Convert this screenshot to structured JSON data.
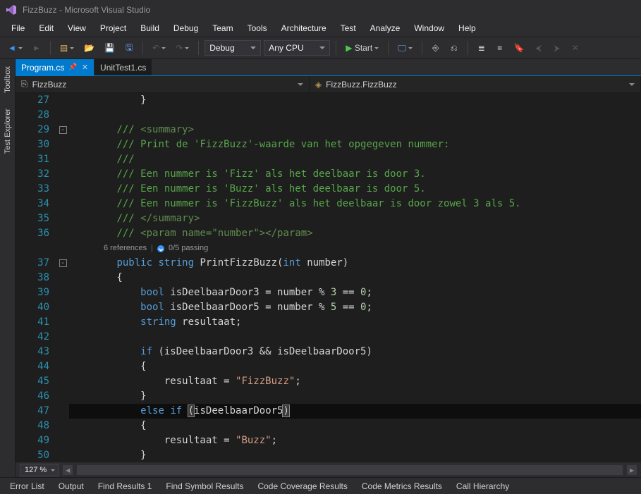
{
  "window": {
    "title": "FizzBuzz - Microsoft Visual Studio"
  },
  "menu": [
    "File",
    "Edit",
    "View",
    "Project",
    "Build",
    "Debug",
    "Team",
    "Tools",
    "Architecture",
    "Test",
    "Analyze",
    "Window",
    "Help"
  ],
  "toolbar": {
    "config": "Debug",
    "platform": "Any CPU",
    "start": "Start"
  },
  "leftTabs": [
    "Toolbox",
    "Test Explorer"
  ],
  "docTabs": [
    {
      "label": "Program.cs",
      "active": true,
      "pinned": true
    },
    {
      "label": "UnitTest1.cs",
      "active": false,
      "pinned": false
    }
  ],
  "navDropdowns": {
    "left": "FizzBuzz",
    "right": "FizzBuzz.FizzBuzz"
  },
  "code": {
    "firstLine": 27,
    "codelens": {
      "refs": "6 references",
      "tests": "0/5 passing"
    },
    "lines": [
      {
        "n": 27,
        "segs": [
          [
            "            }",
            "def"
          ]
        ]
      },
      {
        "n": 28,
        "segs": [
          [
            "",
            "def"
          ]
        ]
      },
      {
        "n": 29,
        "fold": "-",
        "segs": [
          [
            "        ",
            "def"
          ],
          [
            "/// ",
            "com"
          ],
          [
            "<summary>",
            "comg"
          ]
        ]
      },
      {
        "n": 30,
        "segs": [
          [
            "        ",
            "def"
          ],
          [
            "/// ",
            "com"
          ],
          [
            "Print de 'FizzBuzz'-waarde van het opgegeven nummer:",
            "com"
          ]
        ]
      },
      {
        "n": 31,
        "segs": [
          [
            "        ",
            "def"
          ],
          [
            "///",
            "com"
          ]
        ]
      },
      {
        "n": 32,
        "segs": [
          [
            "        ",
            "def"
          ],
          [
            "/// ",
            "com"
          ],
          [
            "Een nummer is 'Fizz' als het deelbaar is door 3.",
            "com"
          ]
        ]
      },
      {
        "n": 33,
        "segs": [
          [
            "        ",
            "def"
          ],
          [
            "/// ",
            "com"
          ],
          [
            "Een nummer is 'Buzz' als het deelbaar is door 5.",
            "com"
          ]
        ]
      },
      {
        "n": 34,
        "segs": [
          [
            "        ",
            "def"
          ],
          [
            "/// ",
            "com"
          ],
          [
            "Een nummer is 'FizzBuzz' als het deelbaar is door zowel 3 als 5.",
            "com"
          ]
        ]
      },
      {
        "n": 35,
        "segs": [
          [
            "        ",
            "def"
          ],
          [
            "/// ",
            "com"
          ],
          [
            "</summary>",
            "comg"
          ]
        ]
      },
      {
        "n": 36,
        "segs": [
          [
            "        ",
            "def"
          ],
          [
            "/// ",
            "com"
          ],
          [
            "<param ",
            "comg"
          ],
          [
            "name",
            "comg"
          ],
          [
            "=",
            "comg"
          ],
          [
            "\"number\"",
            "comg"
          ],
          [
            ">",
            "comg"
          ],
          [
            "</param>",
            "comg"
          ]
        ]
      },
      {
        "n": 0,
        "codelens": true
      },
      {
        "n": 37,
        "fold": "-",
        "segs": [
          [
            "        ",
            "def"
          ],
          [
            "public",
            "kw"
          ],
          [
            " ",
            "def"
          ],
          [
            "string",
            "kw"
          ],
          [
            " ",
            "def"
          ],
          [
            "PrintFizzBuzz",
            "def"
          ],
          [
            "(",
            "def"
          ],
          [
            "int",
            "kw"
          ],
          [
            " ",
            "def"
          ],
          [
            "number",
            "def"
          ],
          [
            ")",
            "def"
          ]
        ]
      },
      {
        "n": 38,
        "segs": [
          [
            "        {",
            "def"
          ]
        ]
      },
      {
        "n": 39,
        "segs": [
          [
            "            ",
            "def"
          ],
          [
            "bool",
            "kw"
          ],
          [
            " isDeelbaarDoor3 = number % ",
            "def"
          ],
          [
            "3",
            "num"
          ],
          [
            " == ",
            "def"
          ],
          [
            "0",
            "num"
          ],
          [
            ";",
            "def"
          ]
        ]
      },
      {
        "n": 40,
        "segs": [
          [
            "            ",
            "def"
          ],
          [
            "bool",
            "kw"
          ],
          [
            " isDeelbaarDoor5 = number % ",
            "def"
          ],
          [
            "5",
            "num"
          ],
          [
            " == ",
            "def"
          ],
          [
            "0",
            "num"
          ],
          [
            ";",
            "def"
          ]
        ]
      },
      {
        "n": 41,
        "segs": [
          [
            "            ",
            "def"
          ],
          [
            "string",
            "kw"
          ],
          [
            " resultaat;",
            "def"
          ]
        ]
      },
      {
        "n": 42,
        "segs": [
          [
            "",
            "def"
          ]
        ]
      },
      {
        "n": 43,
        "segs": [
          [
            "            ",
            "def"
          ],
          [
            "if",
            "kw"
          ],
          [
            " (isDeelbaarDoor3 && isDeelbaarDoor5)",
            "def"
          ]
        ]
      },
      {
        "n": 44,
        "segs": [
          [
            "            {",
            "def"
          ]
        ]
      },
      {
        "n": 45,
        "segs": [
          [
            "                resultaat = ",
            "def"
          ],
          [
            "\"FizzBuzz\"",
            "str"
          ],
          [
            ";",
            "def"
          ]
        ]
      },
      {
        "n": 46,
        "segs": [
          [
            "            }",
            "def"
          ]
        ]
      },
      {
        "n": 47,
        "cursor": true,
        "segs": [
          [
            "            ",
            "def"
          ],
          [
            "else",
            "kw"
          ],
          [
            " ",
            "def"
          ],
          [
            "if",
            "kw"
          ],
          [
            " ",
            "def"
          ],
          [
            "(",
            "br"
          ],
          [
            "isDeelbaarDoor5",
            "def"
          ],
          [
            ")",
            "br"
          ]
        ]
      },
      {
        "n": 48,
        "segs": [
          [
            "            {",
            "def"
          ]
        ]
      },
      {
        "n": 49,
        "segs": [
          [
            "                resultaat = ",
            "def"
          ],
          [
            "\"Buzz\"",
            "str"
          ],
          [
            ";",
            "def"
          ]
        ]
      },
      {
        "n": 50,
        "segs": [
          [
            "            }",
            "def"
          ]
        ]
      }
    ]
  },
  "zoom": "127 %",
  "bottomTabs": [
    "Error List",
    "Output",
    "Find Results 1",
    "Find Symbol Results",
    "Code Coverage Results",
    "Code Metrics Results",
    "Call Hierarchy"
  ]
}
